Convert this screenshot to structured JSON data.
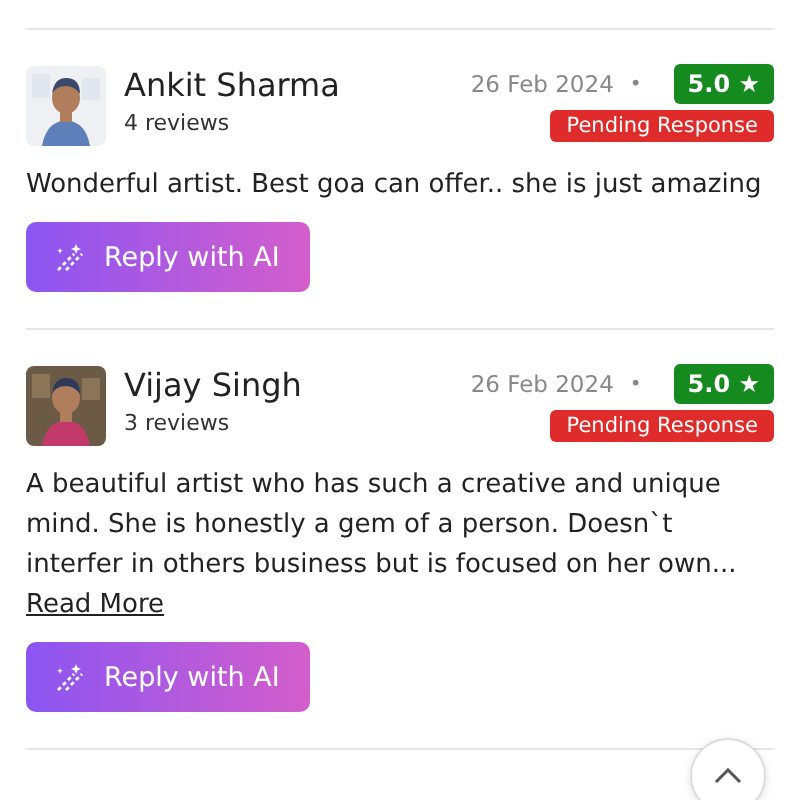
{
  "reviews": [
    {
      "name": "Ankit Sharma",
      "review_count": "4 reviews",
      "date": "26 Feb 2024",
      "separator": "•",
      "rating": "5.0",
      "rating_icon": "★",
      "status": "Pending Response",
      "text": "Wonderful artist. Best goa can offer.. she is just amazing",
      "button": "Reply with AI"
    },
    {
      "name": "Vijay Singh",
      "review_count": "3 reviews",
      "date": "26 Feb 2024",
      "separator": "•",
      "rating": "5.0",
      "rating_icon": "★",
      "status": "Pending Response",
      "text": "A beautiful artist who has such a creative and unique mind. She is honestly a gem of a person. Doesn`t interfer in others business but is focused on her own...",
      "link": "Read More",
      "button": "Reply with AI"
    }
  ]
}
